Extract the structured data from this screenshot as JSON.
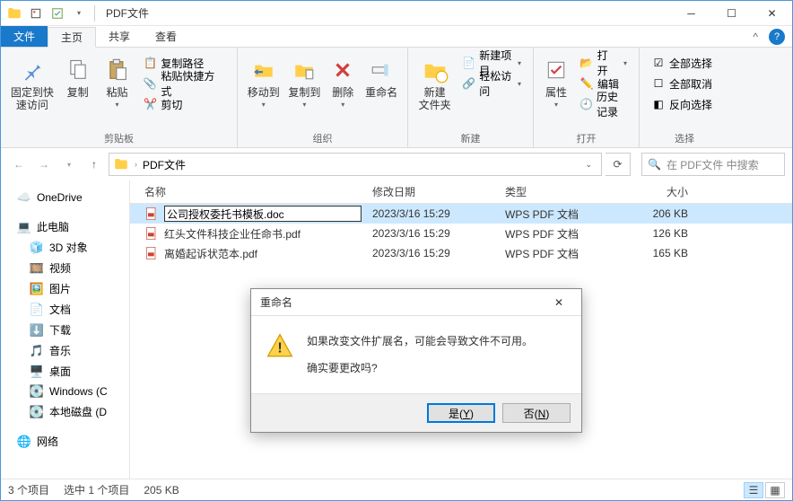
{
  "window": {
    "title": "PDF文件"
  },
  "tabs": {
    "file": "文件",
    "home": "主页",
    "share": "共享",
    "view": "查看"
  },
  "ribbon": {
    "pin": "固定到快\n速访问",
    "copy": "复制",
    "paste": "粘贴",
    "copypath": "复制路径",
    "pasteshortcut": "粘贴快捷方式",
    "cut": "剪切",
    "clipboard_group": "剪贴板",
    "moveto": "移动到",
    "copyto": "复制到",
    "delete": "删除",
    "rename": "重命名",
    "organize_group": "组织",
    "newfolder": "新建\n文件夹",
    "newitem": "新建项目",
    "easyaccess": "轻松访问",
    "new_group": "新建",
    "properties": "属性",
    "open": "打开",
    "edit": "编辑",
    "history": "历史记录",
    "open_group": "打开",
    "selectall": "全部选择",
    "selectnone": "全部取消",
    "invertsel": "反向选择",
    "select_group": "选择"
  },
  "breadcrumb": {
    "seg1": "PDF文件"
  },
  "search": {
    "placeholder": "在 PDF文件 中搜索"
  },
  "columns": {
    "name": "名称",
    "date": "修改日期",
    "type": "类型",
    "size": "大小"
  },
  "files": [
    {
      "name": "公司授权委托书模板.doc",
      "date": "2023/3/16 15:29",
      "type": "WPS PDF 文档",
      "size": "206 KB",
      "editing": true
    },
    {
      "name": "红头文件科技企业任命书.pdf",
      "date": "2023/3/16 15:29",
      "type": "WPS PDF 文档",
      "size": "126 KB"
    },
    {
      "name": "离婚起诉状范本.pdf",
      "date": "2023/3/16 15:29",
      "type": "WPS PDF 文档",
      "size": "165 KB"
    }
  ],
  "sidebar": {
    "onedrive": "OneDrive",
    "thispc": "此电脑",
    "objects3d": "3D 对象",
    "videos": "视频",
    "pictures": "图片",
    "documents": "文档",
    "downloads": "下载",
    "music": "音乐",
    "desktop": "桌面",
    "windowsc": "Windows (C",
    "locald": "本地磁盘 (D",
    "network": "网络"
  },
  "status": {
    "items": "3 个项目",
    "selected": "选中 1 个项目",
    "size": "205 KB"
  },
  "dialog": {
    "title": "重命名",
    "line1": "如果改变文件扩展名，可能会导致文件不可用。",
    "line2": "确实要更改吗?",
    "yes": "是(Y)",
    "no": "否(N)"
  }
}
